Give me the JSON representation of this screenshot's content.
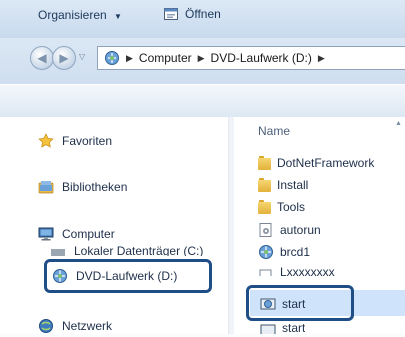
{
  "address": {
    "segments": [
      "Computer",
      "DVD-Laufwerk (D:)"
    ]
  },
  "toolbar": {
    "organize_label": "Organisieren",
    "open_label": "Öffnen"
  },
  "navigation": {
    "favorites": "Favoriten",
    "libraries": "Bibliotheken",
    "computer": "Computer",
    "local_disk": "Lokaler Datenträger (C:)",
    "dvd_drive": "DVD-Laufwerk (D:)",
    "network": "Netzwerk"
  },
  "files": {
    "column_name": "Name",
    "items": [
      {
        "name": "DotNetFramework",
        "icon": "folder-icon"
      },
      {
        "name": "Install",
        "icon": "folder-icon"
      },
      {
        "name": "Tools",
        "icon": "folder-icon"
      },
      {
        "name": "autorun",
        "icon": "settings-file-icon"
      },
      {
        "name": "brcd1",
        "icon": "app-icon"
      },
      {
        "name": "Lxxxxxxxx",
        "icon": "document-icon"
      },
      {
        "name": "start",
        "icon": "app-icon"
      },
      {
        "name": "start",
        "icon": "app-icon"
      }
    ]
  },
  "colors": {
    "highlight_border": "#1f4e86",
    "selection_bg": "#cfe3fb"
  }
}
